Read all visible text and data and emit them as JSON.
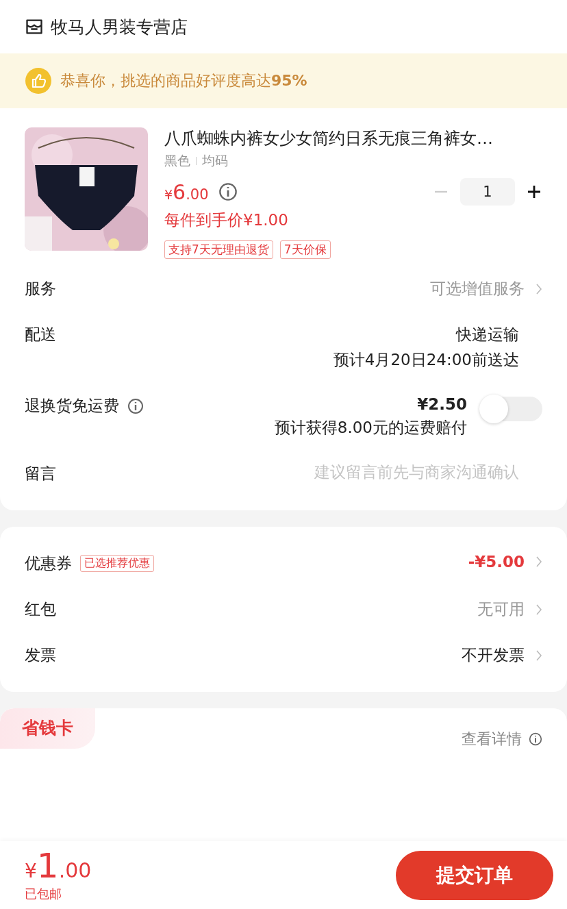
{
  "store": {
    "name": "牧马人男装专营店"
  },
  "banner": {
    "text": "恭喜你，挑选的商品好评度高达",
    "highlight": "95%"
  },
  "product": {
    "title": "八爪蜘蛛内裤女少女简约日系无痕三角裤女…",
    "specs": [
      "黑色",
      "均码"
    ],
    "currency": "¥",
    "price_int": "6",
    "price_dec": ".00",
    "final_price": "每件到手价¥1.00",
    "quantity": "1",
    "tags": [
      "支持7天无理由退货",
      "7天价保"
    ]
  },
  "rows": [
    {
      "kind": "link",
      "label": "服务",
      "value": "可选增值服务",
      "muted": true
    },
    {
      "kind": "lines",
      "label": "配送",
      "lines": [
        "快递运输",
        "预计4月20日24:00前送达"
      ]
    },
    {
      "kind": "toggle",
      "label": "退换货免运费",
      "price": "¥2.50",
      "note": "预计获得8.00元的运费赔付",
      "on": false
    },
    {
      "kind": "input",
      "label": "留言",
      "placeholder": "建议留言前先与商家沟通确认"
    }
  ],
  "discounts": [
    {
      "label": "优惠券",
      "tag": "已选推荐优惠",
      "value": "-¥5.00",
      "accent": true
    },
    {
      "label": "红包",
      "value": "无可用",
      "accent": false,
      "muted": true
    },
    {
      "label": "发票",
      "value": "不开发票",
      "accent": false,
      "muted": false
    }
  ],
  "card": {
    "tab": "省钱卡",
    "details": "查看详情"
  },
  "footer": {
    "currency": "¥",
    "total_int": "1",
    "total_dec": ".00",
    "shipping": "已包邮",
    "submit": "提交订单"
  }
}
